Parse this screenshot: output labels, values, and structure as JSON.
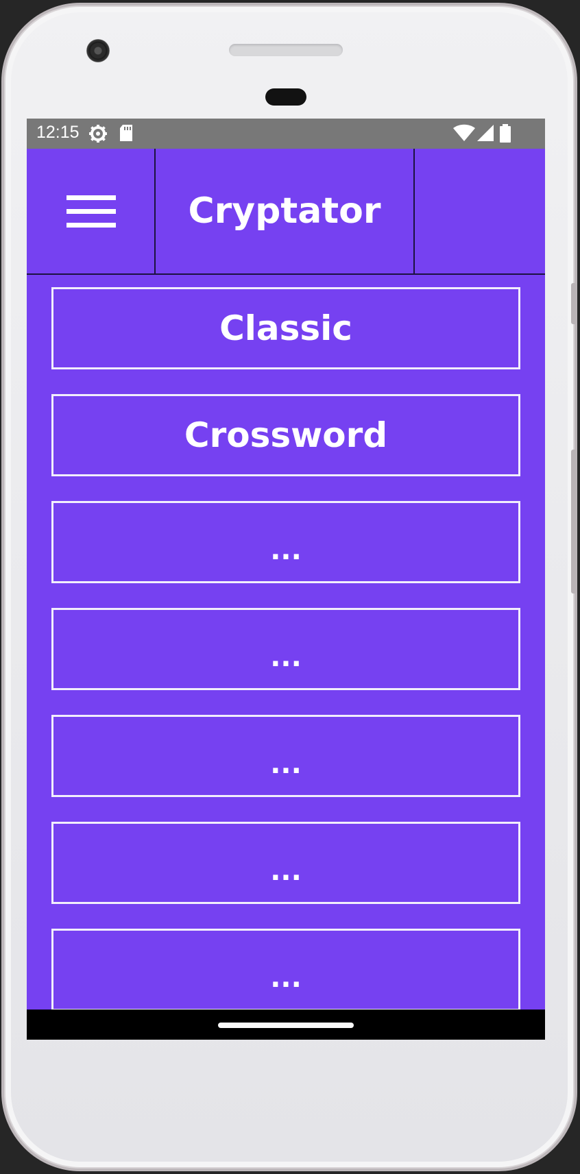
{
  "status_bar": {
    "time": "12:15",
    "icons": [
      "settings-gear-icon",
      "sd-card-icon",
      "wifi-icon",
      "cell-signal-icon",
      "battery-icon"
    ]
  },
  "app_bar": {
    "title": "Cryptator",
    "menu_icon": "hamburger-menu-icon"
  },
  "menu": {
    "items": [
      {
        "label": "Classic"
      },
      {
        "label": "Crossword"
      },
      {
        "label": "..."
      },
      {
        "label": "..."
      },
      {
        "label": "..."
      },
      {
        "label": "..."
      },
      {
        "label": "..."
      }
    ]
  },
  "colors": {
    "primary": "#7641f1",
    "status_bar": "#787878",
    "text": "#ffffff"
  }
}
